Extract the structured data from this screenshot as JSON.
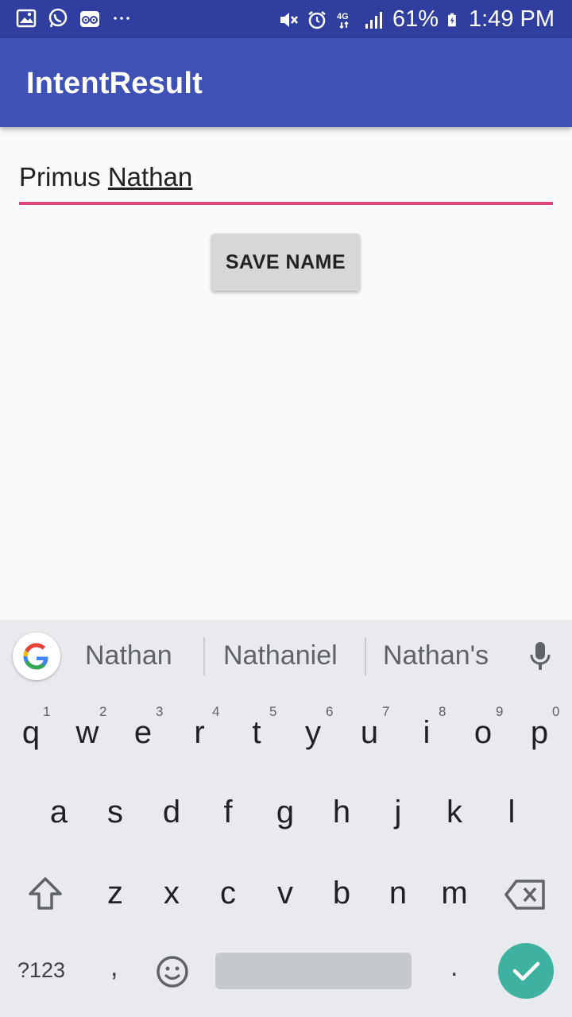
{
  "status_bar": {
    "left_icons": [
      "image-icon",
      "whatsapp-icon",
      "tripadvisor-icon",
      "more-dots-icon"
    ],
    "right_icons": [
      "mute-icon",
      "alarm-icon",
      "network-4g-icon",
      "signal-icon"
    ],
    "battery": "61%",
    "time": "1:49 PM"
  },
  "app_bar": {
    "title": "IntentResult"
  },
  "form": {
    "name_value_part1": "Primus ",
    "name_value_part2": "Nathan",
    "save_button": "SAVE NAME"
  },
  "keyboard": {
    "suggestions": [
      "Nathan",
      "Nathaniel",
      "Nathan's"
    ],
    "row1": [
      "q",
      "w",
      "e",
      "r",
      "t",
      "y",
      "u",
      "i",
      "o",
      "p"
    ],
    "row1_hints": [
      "1",
      "2",
      "3",
      "4",
      "5",
      "6",
      "7",
      "8",
      "9",
      "0"
    ],
    "row2": [
      "a",
      "s",
      "d",
      "f",
      "g",
      "h",
      "j",
      "k",
      "l"
    ],
    "row3": [
      "z",
      "x",
      "c",
      "v",
      "b",
      "n",
      "m"
    ],
    "symbols_key": "?123",
    "comma_key": ",",
    "period_key": ".",
    "accent_color": "#3fb1a0"
  }
}
